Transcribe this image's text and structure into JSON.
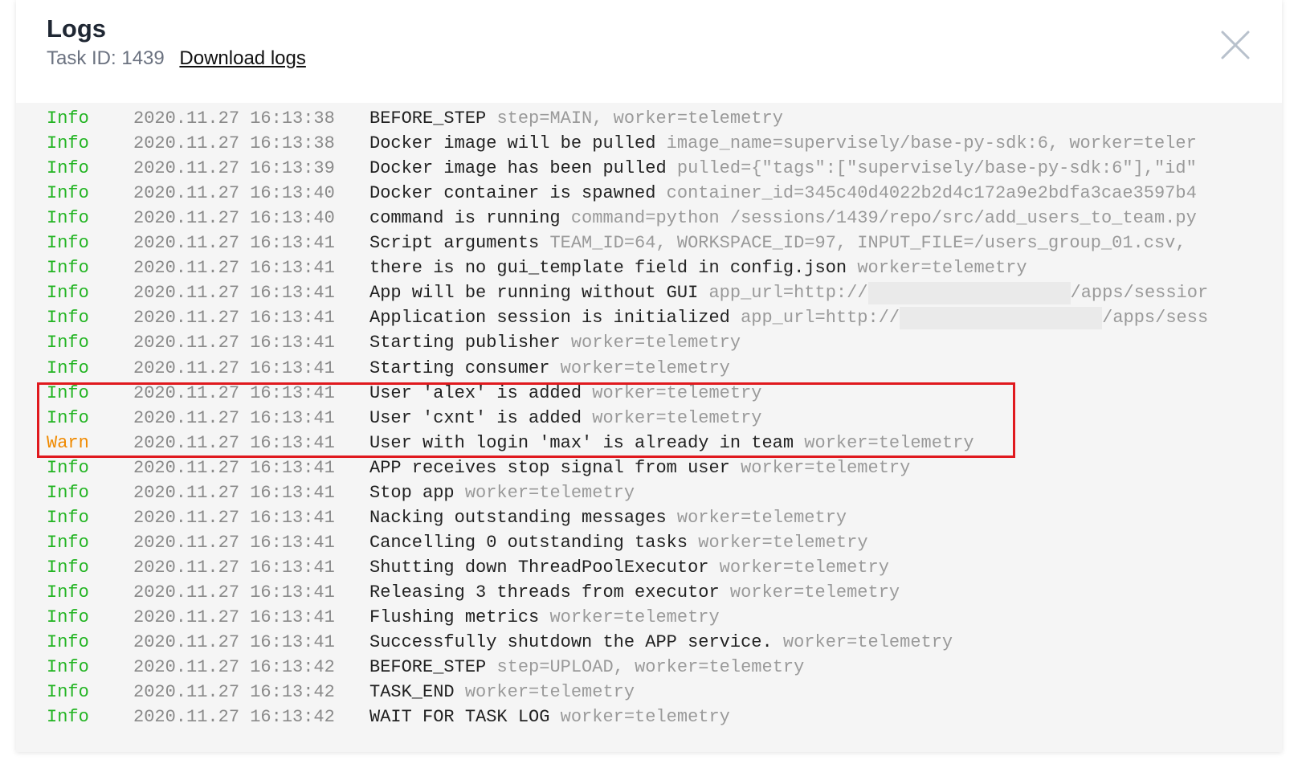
{
  "header": {
    "title": "Logs",
    "task_id": "Task ID: 1439",
    "download_label": "Download logs",
    "close_icon": "close-icon"
  },
  "colors": {
    "info": "#22b422",
    "warn": "#f08a00",
    "highlight_border": "#e0191e"
  },
  "logs": [
    {
      "level": "Info",
      "time": "2020.11.27 16:13:38",
      "message": "BEFORE_STEP",
      "params": "step=MAIN, worker=telemetry"
    },
    {
      "level": "Info",
      "time": "2020.11.27 16:13:38",
      "message": "Docker image will be pulled",
      "params": "image_name=supervisely/base-py-sdk:6, worker=teler"
    },
    {
      "level": "Info",
      "time": "2020.11.27 16:13:39",
      "message": "Docker image has been pulled",
      "params": "pulled={\"tags\":[\"supervisely/base-py-sdk:6\"],\"id\""
    },
    {
      "level": "Info",
      "time": "2020.11.27 16:13:40",
      "message": "Docker container is spawned",
      "params": "container_id=345c40d4022b2d4c172a9e2bdfa3cae3597b4"
    },
    {
      "level": "Info",
      "time": "2020.11.27 16:13:40",
      "message": "command is running",
      "params": "command=python /sessions/1439/repo/src/add_users_to_team.py"
    },
    {
      "level": "Info",
      "time": "2020.11.27 16:13:41",
      "message": "Script arguments",
      "params": "TEAM_ID=64, WORKSPACE_ID=97, INPUT_FILE=/users_group_01.csv,"
    },
    {
      "level": "Info",
      "time": "2020.11.27 16:13:41",
      "message": "there is no gui_template field in config.json",
      "params": "worker=telemetry"
    },
    {
      "level": "Info",
      "time": "2020.11.27 16:13:41",
      "message": "App will be running without GUI",
      "params": "app_url=http://",
      "params_after": "/apps/sessior",
      "redacted": true
    },
    {
      "level": "Info",
      "time": "2020.11.27 16:13:41",
      "message": "Application session is initialized",
      "params": "app_url=http://",
      "params_after": "/apps/sess",
      "redacted": true
    },
    {
      "level": "Info",
      "time": "2020.11.27 16:13:41",
      "message": "Starting publisher",
      "params": "worker=telemetry"
    },
    {
      "level": "Info",
      "time": "2020.11.27 16:13:41",
      "message": "Starting consumer",
      "params": "worker=telemetry"
    },
    {
      "level": "Info",
      "time": "2020.11.27 16:13:41",
      "message": "User 'alex' is added",
      "params": "worker=telemetry"
    },
    {
      "level": "Info",
      "time": "2020.11.27 16:13:41",
      "message": "User 'cxnt' is added",
      "params": "worker=telemetry"
    },
    {
      "level": "Warn",
      "time": "2020.11.27 16:13:41",
      "message": "User with login 'max' is already in team",
      "params": "worker=telemetry"
    },
    {
      "level": "Info",
      "time": "2020.11.27 16:13:41",
      "message": "APP receives stop signal from user",
      "params": "worker=telemetry"
    },
    {
      "level": "Info",
      "time": "2020.11.27 16:13:41",
      "message": "Stop app",
      "params": "worker=telemetry"
    },
    {
      "level": "Info",
      "time": "2020.11.27 16:13:41",
      "message": "Nacking outstanding messages",
      "params": "worker=telemetry"
    },
    {
      "level": "Info",
      "time": "2020.11.27 16:13:41",
      "message": "Cancelling 0 outstanding tasks",
      "params": "worker=telemetry"
    },
    {
      "level": "Info",
      "time": "2020.11.27 16:13:41",
      "message": "Shutting down ThreadPoolExecutor",
      "params": "worker=telemetry"
    },
    {
      "level": "Info",
      "time": "2020.11.27 16:13:41",
      "message": "Releasing 3 threads from executor",
      "params": "worker=telemetry"
    },
    {
      "level": "Info",
      "time": "2020.11.27 16:13:41",
      "message": "Flushing metrics",
      "params": "worker=telemetry"
    },
    {
      "level": "Info",
      "time": "2020.11.27 16:13:41",
      "message": "Successfully shutdown the APP service.",
      "params": "worker=telemetry"
    },
    {
      "level": "Info",
      "time": "2020.11.27 16:13:42",
      "message": "BEFORE_STEP",
      "params": "step=UPLOAD, worker=telemetry"
    },
    {
      "level": "Info",
      "time": "2020.11.27 16:13:42",
      "message": "TASK_END",
      "params": "worker=telemetry"
    },
    {
      "level": "Info",
      "time": "2020.11.27 16:13:42",
      "message": "WAIT FOR TASK LOG",
      "params": "worker=telemetry"
    }
  ]
}
